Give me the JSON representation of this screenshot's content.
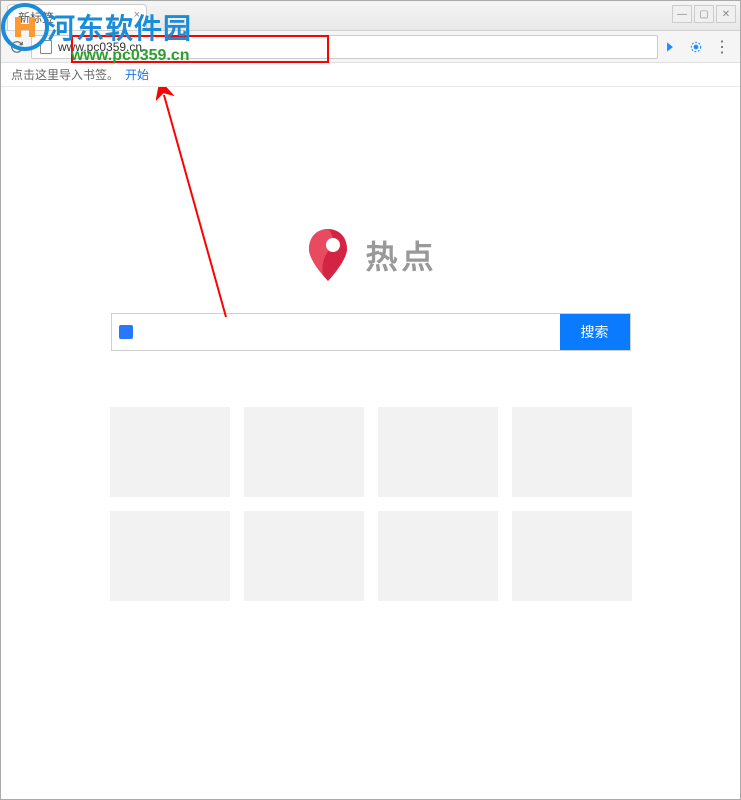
{
  "window": {
    "tab_title": "新标签"
  },
  "address": {
    "url": "www.pc0359.cn"
  },
  "watermark": {
    "text": "河东软件园",
    "url": "www.pc0359.cn"
  },
  "bookmark": {
    "hint": "点击这里导入书签。",
    "link": "开始"
  },
  "brand": {
    "text": "热点"
  },
  "search": {
    "placeholder": "",
    "button": "搜索"
  },
  "tiles": {
    "count": 8
  },
  "colors": {
    "accent_blue": "#0a7bff",
    "watermark_blue": "#1a8cd8",
    "watermark_green": "#2ca02c",
    "highlight_red": "#ff0000"
  }
}
